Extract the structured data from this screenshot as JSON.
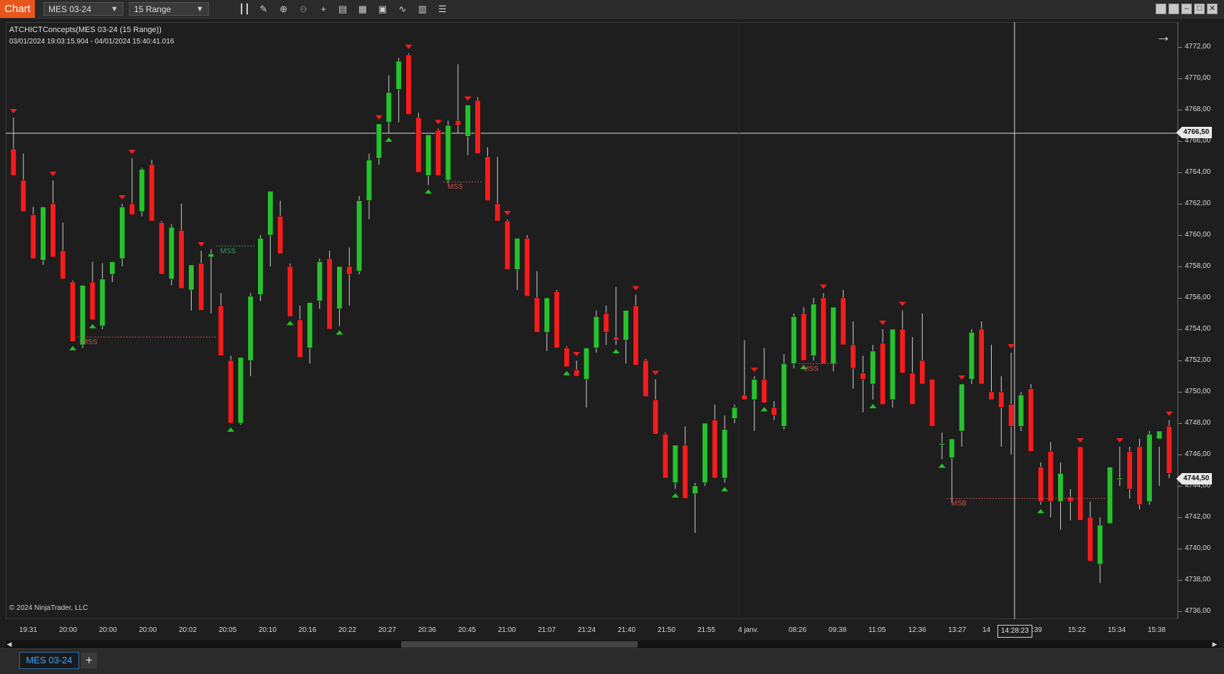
{
  "toolbar": {
    "chart_label": "Chart",
    "instrument": "MES 03-24",
    "bar_type": "15 Range",
    "tools": [
      "bars-icon",
      "pencil-icon",
      "zoom-in-icon",
      "zoom-out-icon",
      "crosshair-icon",
      "properties-icon",
      "data-box-icon",
      "strategies-icon",
      "indicators-icon",
      "calculator-icon",
      "list-icon"
    ]
  },
  "indicator": {
    "title": "ATCHICTConcepts(MES 03-24 (15 Range))",
    "range": "03/01/2024 19:03:15.904 - 04/01/2024 15:40:41.016"
  },
  "copyright": "© 2024 NinjaTrader, LLC",
  "price_axis": [
    "4772,00",
    "4770,00",
    "4768,00",
    "4766,00",
    "4764,00",
    "4762,00",
    "4760,00",
    "4758,00",
    "4756,00",
    "4754,00",
    "4752,00",
    "4750,00",
    "4748,00",
    "4746,00",
    "4744,00",
    "4742,00",
    "4740,00",
    "4738,00",
    "4736,00"
  ],
  "time_axis": [
    "19:31",
    "20:00",
    "20:00",
    "20:00",
    "20:02",
    "20:05",
    "20:10",
    "20:16",
    "20:22",
    "20:27",
    "20:36",
    "20:45",
    "21:00",
    "21:07",
    "21:24",
    "21:40",
    "21:50",
    "21:55",
    "4 janv.",
    "08:26",
    "09:38",
    "11:05",
    "12:36",
    "13:27",
    "14",
    "4:39",
    "15:22",
    "15:34",
    "15:38"
  ],
  "crosshair": {
    "price": "4766,50",
    "time": "14:28:23"
  },
  "last_price": "4744,50",
  "tab": {
    "label": "MES 03-24",
    "add": "+"
  },
  "labels": {
    "mss": "MSS",
    "msb": "MSB"
  },
  "colors": {
    "up": "#27c12e",
    "down": "#f21d1d",
    "background": "#1e1e1e",
    "accent": "#e8561c"
  },
  "chart_data": {
    "type": "candlestick",
    "instrument": "MES 03-24",
    "bar_type": "15 Range",
    "ylim": [
      4736,
      4773
    ],
    "candles": [
      {
        "o": 4765.5,
        "h": 4767.5,
        "l": 4763.8,
        "c": 4763.8
      },
      {
        "o": 4763.5,
        "h": 4765.2,
        "l": 4761.5,
        "c": 4761.5
      },
      {
        "o": 4761.3,
        "h": 4761.8,
        "l": 4758.5,
        "c": 4758.5
      },
      {
        "o": 4758.4,
        "h": 4761.8,
        "l": 4758.1,
        "c": 4761.8
      },
      {
        "o": 4762.0,
        "h": 4763.5,
        "l": 4758.6,
        "c": 4758.6
      },
      {
        "o": 4759.0,
        "h": 4760.8,
        "l": 4757.2,
        "c": 4757.2
      },
      {
        "o": 4757.0,
        "h": 4757.1,
        "l": 4753.2,
        "c": 4753.2
      },
      {
        "o": 4753.0,
        "h": 4756.8,
        "l": 4752.8,
        "c": 4756.8
      },
      {
        "o": 4757.0,
        "h": 4758.3,
        "l": 4754.6,
        "c": 4754.6
      },
      {
        "o": 4754.2,
        "h": 4758.2,
        "l": 4754.0,
        "c": 4757.2
      },
      {
        "o": 4757.5,
        "h": 4758.3,
        "l": 4757.0,
        "c": 4758.3
      },
      {
        "o": 4758.5,
        "h": 4762.0,
        "l": 4758.0,
        "c": 4761.8
      },
      {
        "o": 4762.0,
        "h": 4764.9,
        "l": 4761.3,
        "c": 4761.3
      },
      {
        "o": 4761.5,
        "h": 4764.3,
        "l": 4761.2,
        "c": 4764.2
      },
      {
        "o": 4764.5,
        "h": 4764.8,
        "l": 4760.9,
        "c": 4760.9
      },
      {
        "o": 4760.8,
        "h": 4760.9,
        "l": 4757.5,
        "c": 4757.5
      },
      {
        "o": 4757.2,
        "h": 4760.7,
        "l": 4756.8,
        "c": 4760.5
      },
      {
        "o": 4760.3,
        "h": 4762.0,
        "l": 4756.6,
        "c": 4756.6
      },
      {
        "o": 4756.5,
        "h": 4758.1,
        "l": 4755.2,
        "c": 4758.1
      },
      {
        "o": 4758.2,
        "h": 4759.0,
        "l": 4755.2,
        "c": 4755.2
      },
      {
        "o": 4758.6,
        "h": 4759.1,
        "l": 4755.0,
        "c": 4758.8
      },
      {
        "o": 4755.5,
        "h": 4756.3,
        "l": 4752.3,
        "c": 4752.3
      },
      {
        "o": 4752.0,
        "h": 4752.3,
        "l": 4748.0,
        "c": 4748.0
      },
      {
        "o": 4748.0,
        "h": 4752.2,
        "l": 4747.9,
        "c": 4752.2
      },
      {
        "o": 4752.0,
        "h": 4756.3,
        "l": 4751.0,
        "c": 4756.1
      },
      {
        "o": 4756.2,
        "h": 4760.0,
        "l": 4755.8,
        "c": 4759.8
      },
      {
        "o": 4760.0,
        "h": 4762.8,
        "l": 4758.0,
        "c": 4762.8
      },
      {
        "o": 4761.2,
        "h": 4762.2,
        "l": 4758.8,
        "c": 4758.8
      },
      {
        "o": 4758.0,
        "h": 4758.2,
        "l": 4754.8,
        "c": 4754.8
      },
      {
        "o": 4754.6,
        "h": 4755.5,
        "l": 4752.2,
        "c": 4752.2
      },
      {
        "o": 4752.8,
        "h": 4755.7,
        "l": 4751.8,
        "c": 4755.7
      },
      {
        "o": 4755.8,
        "h": 4758.5,
        "l": 4755.3,
        "c": 4758.3
      },
      {
        "o": 4758.5,
        "h": 4759.0,
        "l": 4754.0,
        "c": 4754.0
      },
      {
        "o": 4755.3,
        "h": 4758.0,
        "l": 4754.2,
        "c": 4758.0
      },
      {
        "o": 4758.0,
        "h": 4759.2,
        "l": 4755.5,
        "c": 4757.5
      },
      {
        "o": 4757.7,
        "h": 4762.5,
        "l": 4757.5,
        "c": 4762.2
      },
      {
        "o": 4762.2,
        "h": 4765.2,
        "l": 4761.0,
        "c": 4764.8
      },
      {
        "o": 4764.9,
        "h": 4767.1,
        "l": 4764.5,
        "c": 4767.1
      },
      {
        "o": 4767.2,
        "h": 4770.2,
        "l": 4766.5,
        "c": 4769.1
      },
      {
        "o": 4769.3,
        "h": 4771.3,
        "l": 4767.2,
        "c": 4771.1
      },
      {
        "o": 4771.5,
        "h": 4771.6,
        "l": 4767.7,
        "c": 4767.7
      },
      {
        "o": 4767.5,
        "h": 4767.8,
        "l": 4764.0,
        "c": 4764.0
      },
      {
        "o": 4763.8,
        "h": 4766.4,
        "l": 4763.2,
        "c": 4766.4
      },
      {
        "o": 4766.7,
        "h": 4766.8,
        "l": 4763.8,
        "c": 4763.8
      },
      {
        "o": 4763.5,
        "h": 4767.3,
        "l": 4763.3,
        "c": 4767.0
      },
      {
        "o": 4767.3,
        "h": 4770.9,
        "l": 4766.5,
        "c": 4767.0
      },
      {
        "o": 4766.3,
        "h": 4768.3,
        "l": 4765.1,
        "c": 4768.3
      },
      {
        "o": 4768.6,
        "h": 4768.8,
        "l": 4765.2,
        "c": 4765.2
      },
      {
        "o": 4765.0,
        "h": 4765.6,
        "l": 4762.2,
        "c": 4762.2
      },
      {
        "o": 4762.0,
        "h": 4765.0,
        "l": 4760.9,
        "c": 4760.9
      },
      {
        "o": 4760.9,
        "h": 4761.0,
        "l": 4757.8,
        "c": 4757.8
      },
      {
        "o": 4757.8,
        "h": 4759.8,
        "l": 4756.5,
        "c": 4759.8
      },
      {
        "o": 4759.8,
        "h": 4760.0,
        "l": 4756.1,
        "c": 4756.1
      },
      {
        "o": 4756.0,
        "h": 4757.7,
        "l": 4753.8,
        "c": 4753.8
      },
      {
        "o": 4753.8,
        "h": 4756.0,
        "l": 4752.6,
        "c": 4756.0
      },
      {
        "o": 4756.4,
        "h": 4756.5,
        "l": 4752.8,
        "c": 4752.8
      },
      {
        "o": 4752.8,
        "h": 4752.9,
        "l": 4751.6,
        "c": 4751.6
      },
      {
        "o": 4751.4,
        "h": 4752.0,
        "l": 4751.0,
        "c": 4751.0
      },
      {
        "o": 4750.8,
        "h": 4752.8,
        "l": 4749.0,
        "c": 4752.8
      },
      {
        "o": 4752.8,
        "h": 4755.2,
        "l": 4752.5,
        "c": 4754.8
      },
      {
        "o": 4755.0,
        "h": 4755.5,
        "l": 4753.0,
        "c": 4753.8
      },
      {
        "o": 4753.5,
        "h": 4756.7,
        "l": 4753.0,
        "c": 4753.3
      },
      {
        "o": 4753.3,
        "h": 4755.2,
        "l": 4751.8,
        "c": 4755.2
      },
      {
        "o": 4755.5,
        "h": 4756.2,
        "l": 4751.7,
        "c": 4751.7
      },
      {
        "o": 4752.0,
        "h": 4752.1,
        "l": 4749.7,
        "c": 4749.7
      },
      {
        "o": 4749.5,
        "h": 4750.8,
        "l": 4747.3,
        "c": 4747.3
      },
      {
        "o": 4747.3,
        "h": 4747.4,
        "l": 4744.5,
        "c": 4744.5
      },
      {
        "o": 4744.2,
        "h": 4746.6,
        "l": 4743.8,
        "c": 4746.6
      },
      {
        "o": 4746.6,
        "h": 4747.8,
        "l": 4743.2,
        "c": 4743.2
      },
      {
        "o": 4743.5,
        "h": 4744.2,
        "l": 4741.0,
        "c": 4744.0
      },
      {
        "o": 4744.2,
        "h": 4748.0,
        "l": 4744.0,
        "c": 4748.0
      },
      {
        "o": 4748.2,
        "h": 4749.2,
        "l": 4744.5,
        "c": 4744.5
      },
      {
        "o": 4744.5,
        "h": 4748.5,
        "l": 4744.2,
        "c": 4747.6
      },
      {
        "o": 4748.3,
        "h": 4749.2,
        "l": 4748.0,
        "c": 4749.0
      },
      {
        "o": 4749.8,
        "h": 4753.3,
        "l": 4749.5,
        "c": 4749.5
      },
      {
        "o": 4749.5,
        "h": 4751.0,
        "l": 4747.5,
        "c": 4750.8
      },
      {
        "o": 4750.8,
        "h": 4752.8,
        "l": 4749.3,
        "c": 4749.3
      },
      {
        "o": 4749.0,
        "h": 4749.4,
        "l": 4748.2,
        "c": 4748.5
      },
      {
        "o": 4747.8,
        "h": 4752.4,
        "l": 4747.6,
        "c": 4751.8
      },
      {
        "o": 4751.8,
        "h": 4755.0,
        "l": 4751.5,
        "c": 4754.8
      },
      {
        "o": 4755.0,
        "h": 4755.4,
        "l": 4752.0,
        "c": 4752.0
      },
      {
        "o": 4752.3,
        "h": 4756.0,
        "l": 4752.0,
        "c": 4755.6
      },
      {
        "o": 4756.0,
        "h": 4756.3,
        "l": 4751.8,
        "c": 4751.8
      },
      {
        "o": 4751.8,
        "h": 4755.4,
        "l": 4751.3,
        "c": 4755.4
      },
      {
        "o": 4756.0,
        "h": 4756.5,
        "l": 4753.0,
        "c": 4753.0
      },
      {
        "o": 4753.0,
        "h": 4754.5,
        "l": 4750.2,
        "c": 4751.5
      },
      {
        "o": 4751.2,
        "h": 4752.3,
        "l": 4748.7,
        "c": 4750.8
      },
      {
        "o": 4750.5,
        "h": 4753.0,
        "l": 4749.5,
        "c": 4752.6
      },
      {
        "o": 4753.1,
        "h": 4754.0,
        "l": 4749.2,
        "c": 4749.2
      },
      {
        "o": 4749.5,
        "h": 4754.0,
        "l": 4749.0,
        "c": 4754.0
      },
      {
        "o": 4754.0,
        "h": 4755.2,
        "l": 4751.2,
        "c": 4751.2
      },
      {
        "o": 4751.2,
        "h": 4753.5,
        "l": 4749.2,
        "c": 4749.2
      },
      {
        "o": 4752.0,
        "h": 4755.0,
        "l": 4750.5,
        "c": 4750.5
      },
      {
        "o": 4750.8,
        "h": 4750.8,
        "l": 4747.8,
        "c": 4747.8
      },
      {
        "o": 4746.7,
        "h": 4747.4,
        "l": 4745.7,
        "c": 4746.7
      },
      {
        "o": 4745.8,
        "h": 4747.0,
        "l": 4742.9,
        "c": 4747.0
      },
      {
        "o": 4747.5,
        "h": 4750.5,
        "l": 4746.5,
        "c": 4750.5
      },
      {
        "o": 4750.8,
        "h": 4754.0,
        "l": 4750.5,
        "c": 4753.8
      },
      {
        "o": 4754.0,
        "h": 4754.5,
        "l": 4750.5,
        "c": 4750.5
      },
      {
        "o": 4750.0,
        "h": 4753.0,
        "l": 4749.5,
        "c": 4749.5
      },
      {
        "o": 4750.0,
        "h": 4751.0,
        "l": 4746.5,
        "c": 4749.0
      },
      {
        "o": 4749.2,
        "h": 4752.5,
        "l": 4746.0,
        "c": 4747.8
      },
      {
        "o": 4747.8,
        "h": 4750.0,
        "l": 4747.5,
        "c": 4749.8
      },
      {
        "o": 4750.2,
        "h": 4750.5,
        "l": 4746.2,
        "c": 4746.2
      },
      {
        "o": 4745.2,
        "h": 4745.5,
        "l": 4742.8,
        "c": 4743.0
      },
      {
        "o": 4746.2,
        "h": 4746.8,
        "l": 4742.0,
        "c": 4743.0
      },
      {
        "o": 4743.0,
        "h": 4745.5,
        "l": 4741.2,
        "c": 4744.8
      },
      {
        "o": 4743.3,
        "h": 4743.8,
        "l": 4741.8,
        "c": 4743.0
      },
      {
        "o": 4746.5,
        "h": 4746.5,
        "l": 4741.8,
        "c": 4741.8
      },
      {
        "o": 4742.0,
        "h": 4743.0,
        "l": 4739.2,
        "c": 4739.2
      },
      {
        "o": 4739.0,
        "h": 4742.0,
        "l": 4737.8,
        "c": 4741.5
      },
      {
        "o": 4741.6,
        "h": 4745.2,
        "l": 4741.6,
        "c": 4745.2
      },
      {
        "o": 4744.5,
        "h": 4746.5,
        "l": 4744.0,
        "c": 4744.5
      },
      {
        "o": 4746.2,
        "h": 4746.5,
        "l": 4743.2,
        "c": 4743.8
      },
      {
        "o": 4746.5,
        "h": 4747.0,
        "l": 4742.5,
        "c": 4742.8
      },
      {
        "o": 4743.0,
        "h": 4747.5,
        "l": 4742.8,
        "c": 4747.3
      },
      {
        "o": 4747.0,
        "h": 4746.5,
        "l": 4744.0,
        "c": 4747.5
      },
      {
        "o": 4747.8,
        "h": 4748.2,
        "l": 4744.5,
        "c": 4744.8
      }
    ],
    "annotations": [
      {
        "label": "MSS",
        "price": 4753.5
      },
      {
        "label": "MSS",
        "price": 4759.3
      },
      {
        "label": "MSS",
        "price": 4763.4
      },
      {
        "label": "MSS",
        "price": 4751.8
      },
      {
        "label": "MSB",
        "price": 4743.2
      }
    ]
  }
}
